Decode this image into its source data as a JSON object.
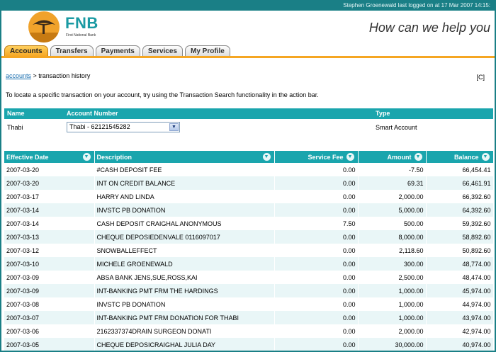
{
  "login_bar": {
    "text": "Stephen Groenewald last logged on at 17 Mar 2007 14:15:"
  },
  "brand": {
    "name": "FNB",
    "subtitle": "First National Bank",
    "tagline": "How can we help you"
  },
  "tabs": [
    {
      "label": "Accounts",
      "active": true
    },
    {
      "label": "Transfers",
      "active": false
    },
    {
      "label": "Payments",
      "active": false
    },
    {
      "label": "Services",
      "active": false
    },
    {
      "label": "My Profile",
      "active": false
    }
  ],
  "breadcrumb": {
    "link": "accounts",
    "rest": " > transaction history"
  },
  "corner": "[C]",
  "instructions": "To locate a specific transaction on your account, try using the Transaction Search functionality in the action bar.",
  "account": {
    "headers": {
      "name": "Name",
      "number": "Account Number",
      "type": "Type"
    },
    "name": "Thabi",
    "selected": "Thabi - 62121545282",
    "type": "Smart Account"
  },
  "table": {
    "columns": [
      "Effective Date",
      "Description",
      "Service Fee",
      "Amount",
      "Balance"
    ],
    "rows": [
      [
        "2007-03-20",
        "#CASH DEPOSIT FEE",
        "0.00",
        "-7.50",
        "66,454.41"
      ],
      [
        "2007-03-20",
        "INT ON CREDIT BALANCE",
        "0.00",
        "69.31",
        "66,461.91"
      ],
      [
        "2007-03-17",
        "HARRY AND LINDA",
        "0.00",
        "2,000.00",
        "66,392.60"
      ],
      [
        "2007-03-14",
        "INVSTC PB DONATION",
        "0.00",
        "5,000.00",
        "64,392.60"
      ],
      [
        "2007-03-14",
        "CASH DEPOSIT CRAIGHAL ANONYMOUS",
        "7.50",
        "500.00",
        "59,392.60"
      ],
      [
        "2007-03-13",
        "CHEQUE DEPOSIEDENVALE 0116097017",
        "0.00",
        "8,000.00",
        "58,892.60"
      ],
      [
        "2007-03-12",
        "SNOWBALLEFFECT",
        "0.00",
        "2,118.60",
        "50,892.60"
      ],
      [
        "2007-03-10",
        "MICHELE GROENEWALD",
        "0.00",
        "300.00",
        "48,774.00"
      ],
      [
        "2007-03-09",
        "ABSA BANK JENS,SUE,ROSS,KAI",
        "0.00",
        "2,500.00",
        "48,474.00"
      ],
      [
        "2007-03-09",
        "INT-BANKING PMT FRM THE HARDINGS",
        "0.00",
        "1,000.00",
        "45,974.00"
      ],
      [
        "2007-03-08",
        "INVSTC PB DONATION",
        "0.00",
        "1,000.00",
        "44,974.00"
      ],
      [
        "2007-03-07",
        "INT-BANKING PMT FRM DONATION FOR THABI",
        "0.00",
        "1,000.00",
        "43,974.00"
      ],
      [
        "2007-03-06",
        "2162337374DRAIN SURGEON DONATI",
        "0.00",
        "2,000.00",
        "42,974.00"
      ],
      [
        "2007-03-05",
        "CHEQUE DEPOSICRAIGHAL JULIA DAY",
        "0.00",
        "30,000.00",
        "40,974.00"
      ]
    ]
  },
  "colors": {
    "teal": "#1aa5ad",
    "orange": "#f5a623",
    "dark_teal": "#1a7f86"
  }
}
